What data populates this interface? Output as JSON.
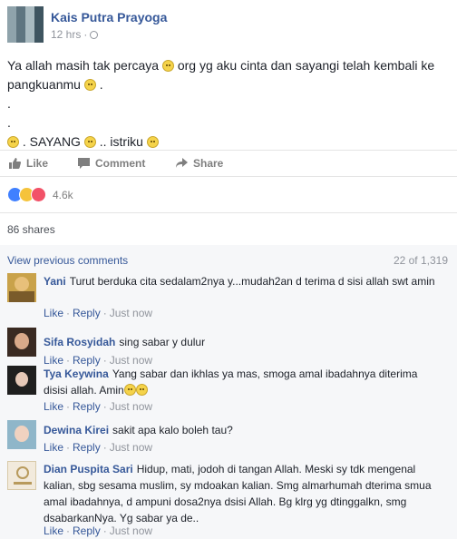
{
  "post": {
    "author": "Kais Putra Prayoga",
    "time": "12 hrs",
    "separator": "·",
    "body_line1": "Ya allah masih tak percaya",
    "body_line1b": "org yg aku cinta dan sayangi telah kembali ke",
    "body_line2": "pangkuanmu",
    "body_line2b": ".",
    "body_dot1": ".",
    "body_dot2": ".",
    "body_line5a": ". SAYANG",
    "body_line5b": ".. istriku"
  },
  "actions": {
    "like": "Like",
    "comment": "Comment",
    "share": "Share"
  },
  "reactions": {
    "count": "4.6k",
    "types": [
      "like-icon",
      "sad-icon",
      "love-icon"
    ],
    "colors": {
      "like": "#4080ff",
      "sad": "#f5c33b",
      "love": "#f25268"
    }
  },
  "shares": "86 shares",
  "comments_section": {
    "view_previous": "View previous comments",
    "count": "22 of 1,319",
    "action_like": "Like",
    "action_reply": "Reply",
    "time": "Just now",
    "dot": "·",
    "items": [
      {
        "name": "Yani",
        "text": "Turut berduka cita sedalam2nya y...mudah2an d terima d sisi allah swt amin"
      },
      {
        "name": "Sifa Rosyidah",
        "text": "sing sabar y dulur"
      },
      {
        "name": "Tya Keywina",
        "text": "Yang sabar dan ikhlas ya mas, smoga amal ibadahnya diterima disisi allah. Amin"
      },
      {
        "name": "Dewina Kirei",
        "text": "sakit apa kalo boleh tau?"
      },
      {
        "name": "Dian Puspita Sari",
        "text": "Hidup, mati, jodoh di tangan Allah. Meski sy tdk mengenal kalian, sbg sesama muslim, sy mdoakan kalian. Smg almarhumah dterima smua amal ibadahnya, d ampuni dosa2nya dsisi Allah. Bg klrg yg dtinggalkn, smg dsabarkanNya. Yg sabar ya de.."
      }
    ]
  },
  "colors": {
    "link": "#365899",
    "muted": "#90949c",
    "comment_bg": "#f6f7f9"
  }
}
